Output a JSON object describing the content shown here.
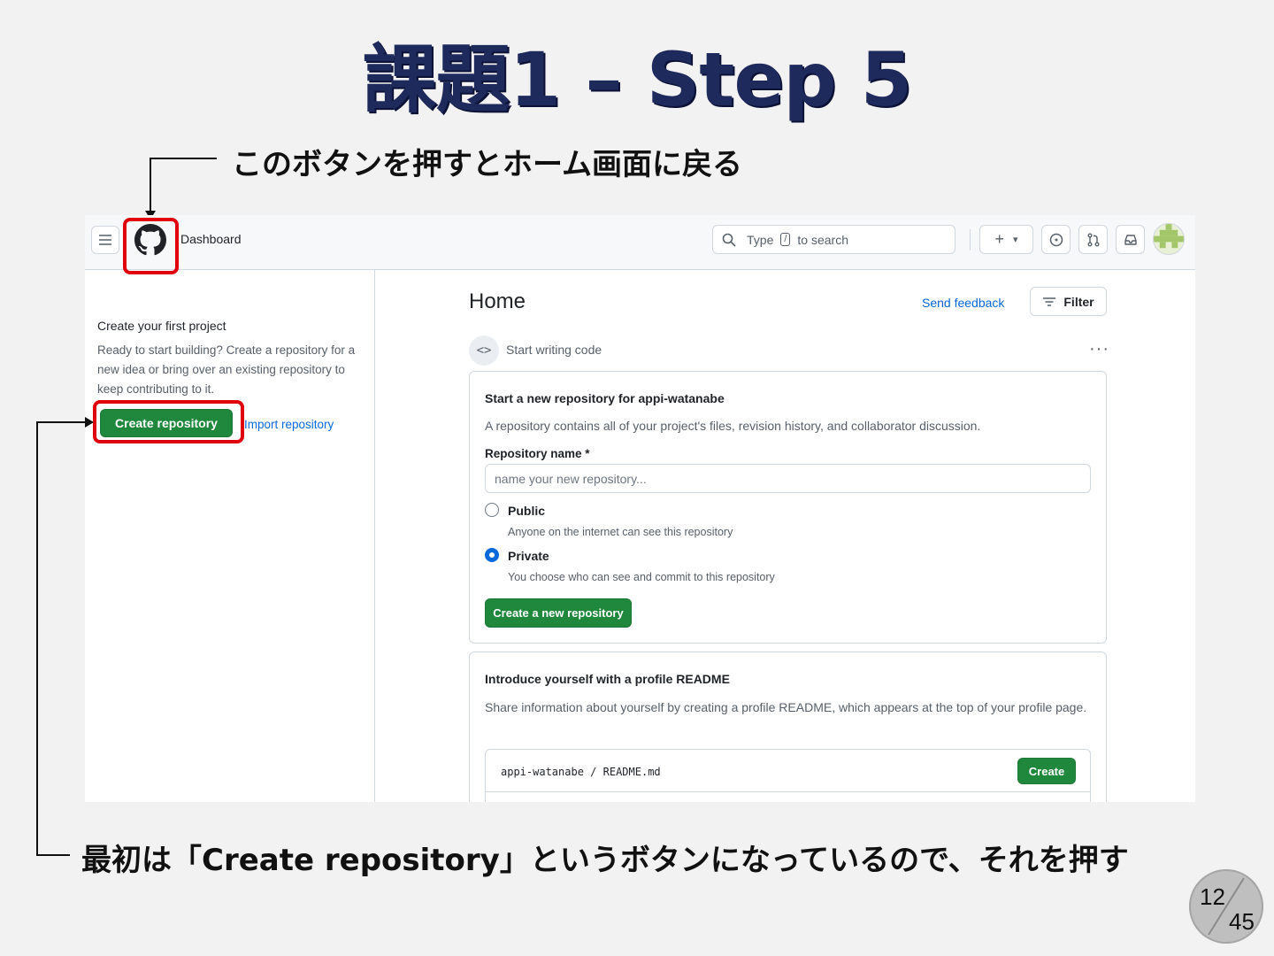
{
  "slide": {
    "title": "課題1 – Step 5",
    "callout_top": "このボタンを押すとホーム画面に戻る",
    "callout_bottom": "最初は「Create repository」というボタンになっているので、それを押す",
    "page_current": "12",
    "page_total": "45"
  },
  "header": {
    "dashboard_label": "Dashboard",
    "search_prefix": "Type",
    "search_key": "/",
    "search_suffix": "to search",
    "plus_label": "+",
    "caret": "▾"
  },
  "sidebar": {
    "title": "Create your first project",
    "description": "Ready to start building? Create a repository for a new idea or bring over an existing repository to keep contributing to it.",
    "create_button": "Create repository",
    "import_link": "Import repository"
  },
  "main": {
    "heading": "Home",
    "send_feedback": "Send feedback",
    "filter_label": "Filter",
    "start_writing": "Start writing code",
    "more": "···",
    "code_symbol": "<>"
  },
  "new_repo_card": {
    "title": "Start a new repository for appi-watanabe",
    "description": "A repository contains all of your project's files, revision history, and collaborator discussion.",
    "name_label": "Repository name *",
    "name_placeholder": "name your new repository...",
    "public_label": "Public",
    "public_desc": "Anyone on the internet can see this repository",
    "private_label": "Private",
    "private_desc": "You choose who can see and commit to this repository",
    "selected_visibility": "Private",
    "create_button": "Create a new repository"
  },
  "readme_card": {
    "title": "Introduce yourself with a profile README",
    "description": "Share information about yourself by creating a profile README, which appears at the top of your profile page.",
    "path_user": "appi-watanabe",
    "path_sep": "/",
    "path_file": "README.md",
    "create_button": "Create"
  },
  "colors": {
    "accent_green": "#1f883d",
    "link_blue": "#0969da",
    "highlight_red": "#e0000c",
    "title_navy": "#1f2a5c"
  }
}
